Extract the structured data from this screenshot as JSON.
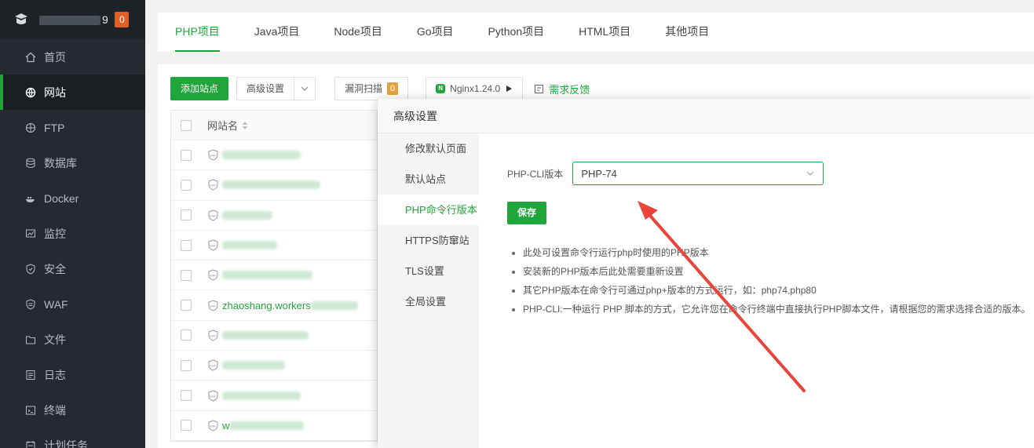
{
  "sidebar": {
    "ip_prefix": "",
    "ip_suffix": "9",
    "badge": "0",
    "items": [
      {
        "label": "首页",
        "icon": "home-icon"
      },
      {
        "label": "网站",
        "icon": "globe-icon",
        "active": true
      },
      {
        "label": "FTP",
        "icon": "ftp-globe-icon"
      },
      {
        "label": "数据库",
        "icon": "database-icon"
      },
      {
        "label": "Docker",
        "icon": "docker-icon"
      },
      {
        "label": "监控",
        "icon": "monitor-icon"
      },
      {
        "label": "安全",
        "icon": "shield-icon"
      },
      {
        "label": "WAF",
        "icon": "waf-icon"
      },
      {
        "label": "文件",
        "icon": "folder-icon"
      },
      {
        "label": "日志",
        "icon": "log-icon"
      },
      {
        "label": "终端",
        "icon": "terminal-icon"
      },
      {
        "label": "计划任务",
        "icon": "cron-icon"
      }
    ]
  },
  "tabs": [
    "PHP项目",
    "Java项目",
    "Node项目",
    "Go项目",
    "Python项目",
    "HTML项目",
    "其他项目"
  ],
  "toolbar": {
    "add_site": "添加站点",
    "advanced": "高级设置",
    "scan": "漏洞扫描",
    "scan_count": "0",
    "nginx": "Nginx1.24.0",
    "feedback": "需求反馈"
  },
  "table": {
    "header": "网站名",
    "rows": [
      {
        "text": "",
        "blur": 100
      },
      {
        "text": "",
        "blur": 125
      },
      {
        "text": "",
        "blur": 64
      },
      {
        "text": "",
        "blur": 70
      },
      {
        "text": "",
        "blur": 115
      },
      {
        "text": "zhaoshang.workers",
        "blur": 60
      },
      {
        "text": "",
        "blur": 110
      },
      {
        "text": "",
        "blur": 80
      },
      {
        "text": "",
        "blur": 100
      },
      {
        "text": "w",
        "blur": 95
      }
    ]
  },
  "dialog": {
    "title": "高级设置",
    "tabs": [
      "修改默认页面",
      "默认站点",
      "PHP命令行版本",
      "HTTPS防窜站",
      "TLS设置",
      "全局设置"
    ],
    "active_tab": 2,
    "field_label": "PHP-CLI版本",
    "select_value": "PHP-74",
    "save": "保存",
    "tips": [
      "此处可设置命令行运行php时使用的PHP版本",
      "安装新的PHP版本后此处需要重新设置",
      "其它PHP版本在命令行可通过php+版本的方式运行，如：php74,php80",
      "PHP-CLI:一种运行 PHP 脚本的方式，它允许您在命令行终端中直接执行PHP脚本文件，请根据您的需求选择合适的版本。"
    ]
  },
  "colors": {
    "accent": "#20a53a",
    "sidebar": "#252a30",
    "arrow": "#e8443a"
  }
}
